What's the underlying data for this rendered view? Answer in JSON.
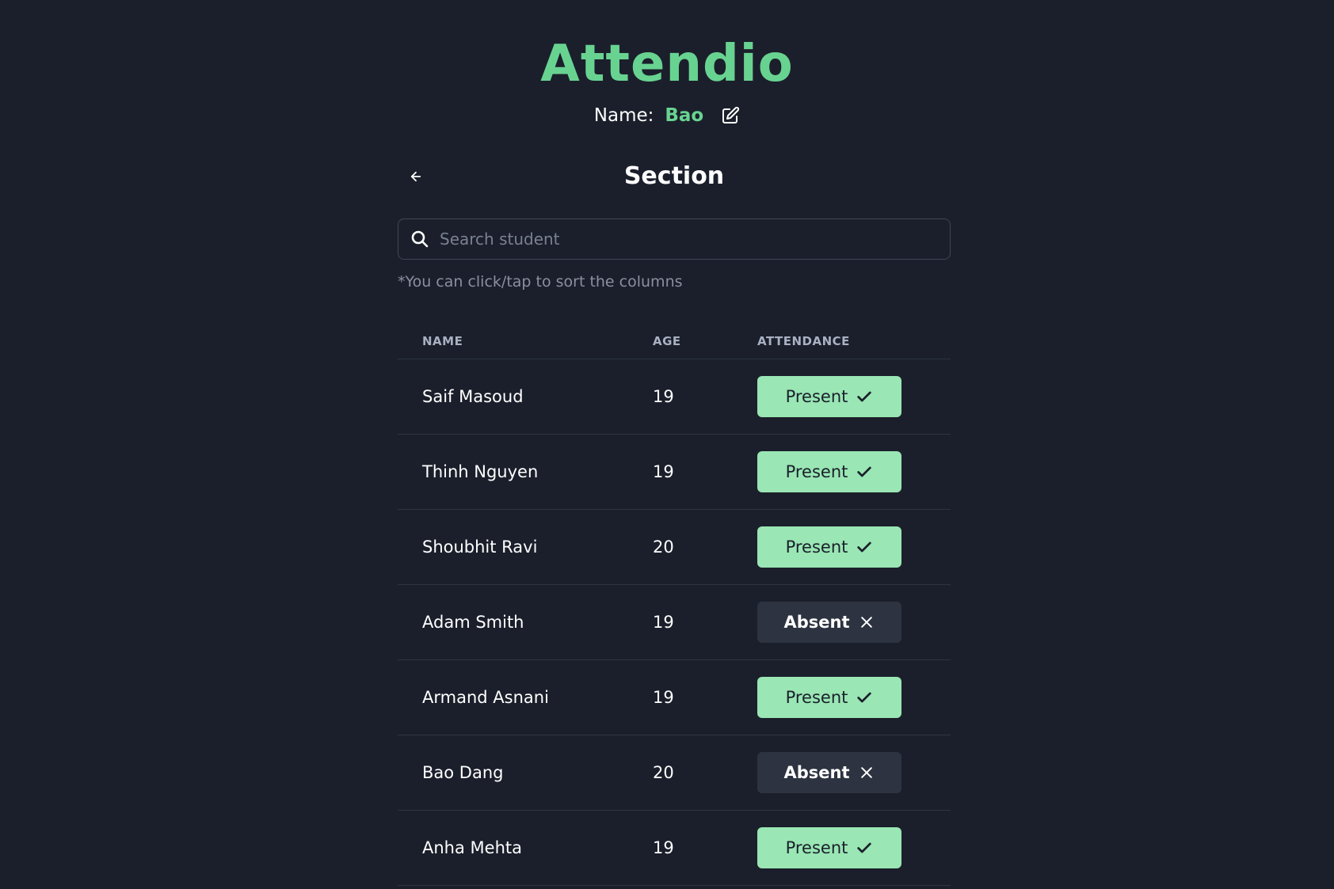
{
  "app": {
    "title": "Attendio",
    "name_label": "Name:",
    "name_value": "Bao"
  },
  "section": {
    "title": "Section"
  },
  "search": {
    "placeholder": "Search student",
    "value": ""
  },
  "hint": "*You can click/tap to sort the columns",
  "table": {
    "headers": {
      "name": "NAME",
      "age": "AGE",
      "attendance": "ATTENDANCE"
    },
    "rows": [
      {
        "name": "Saif Masoud",
        "age": "19",
        "status": "present",
        "label": "Present"
      },
      {
        "name": "Thinh Nguyen",
        "age": "19",
        "status": "present",
        "label": "Present"
      },
      {
        "name": "Shoubhit Ravi",
        "age": "20",
        "status": "present",
        "label": "Present"
      },
      {
        "name": "Adam Smith",
        "age": "19",
        "status": "absent",
        "label": "Absent"
      },
      {
        "name": "Armand Asnani",
        "age": "19",
        "status": "present",
        "label": "Present"
      },
      {
        "name": "Bao Dang",
        "age": "20",
        "status": "absent",
        "label": "Absent"
      },
      {
        "name": "Anha Mehta",
        "age": "19",
        "status": "present",
        "label": "Present"
      }
    ]
  },
  "icons": {
    "edit": "edit-icon",
    "back": "arrow-left-icon",
    "search": "search-icon",
    "present": "check-icon",
    "absent": "x-icon"
  },
  "colors": {
    "background": "#1b1f2b",
    "accent": "#68d391",
    "present_bg": "#9ae6b4",
    "absent_bg": "#2d3340"
  }
}
